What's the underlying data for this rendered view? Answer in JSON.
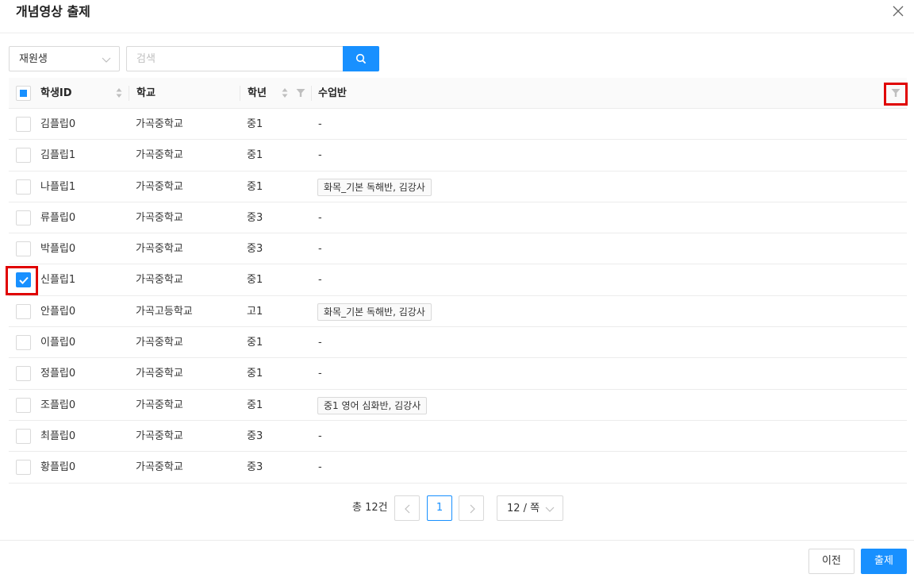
{
  "modal": {
    "title": "개념영상 출제"
  },
  "toolbar": {
    "filter_select_value": "재원생",
    "search_placeholder": "검색"
  },
  "table": {
    "columns": {
      "student_id": "학생ID",
      "school": "학교",
      "grade": "학년",
      "class": "수업반"
    },
    "rows": [
      {
        "name": "김플립0",
        "school": "가곡중학교",
        "grade": "중1",
        "class": "-",
        "class_is_tag": false,
        "checked": false
      },
      {
        "name": "김플립1",
        "school": "가곡중학교",
        "grade": "중1",
        "class": "-",
        "class_is_tag": false,
        "checked": false
      },
      {
        "name": "나플립1",
        "school": "가곡중학교",
        "grade": "중1",
        "class": "화목_기본 독해반, 김강사",
        "class_is_tag": true,
        "checked": false
      },
      {
        "name": "류플립0",
        "school": "가곡중학교",
        "grade": "중3",
        "class": "-",
        "class_is_tag": false,
        "checked": false
      },
      {
        "name": "박플립0",
        "school": "가곡중학교",
        "grade": "중3",
        "class": "-",
        "class_is_tag": false,
        "checked": false
      },
      {
        "name": "신플립1",
        "school": "가곡중학교",
        "grade": "중1",
        "class": "-",
        "class_is_tag": false,
        "checked": true
      },
      {
        "name": "안플립0",
        "school": "가곡고등학교",
        "grade": "고1",
        "class": "화목_기본 독해반, 김강사",
        "class_is_tag": true,
        "checked": false
      },
      {
        "name": "이플립0",
        "school": "가곡중학교",
        "grade": "중1",
        "class": "-",
        "class_is_tag": false,
        "checked": false
      },
      {
        "name": "정플립0",
        "school": "가곡중학교",
        "grade": "중1",
        "class": "-",
        "class_is_tag": false,
        "checked": false
      },
      {
        "name": "조플립0",
        "school": "가곡중학교",
        "grade": "중1",
        "class": "중1 영어 심화반, 김강사",
        "class_is_tag": true,
        "checked": false
      },
      {
        "name": "최플립0",
        "school": "가곡중학교",
        "grade": "중3",
        "class": "-",
        "class_is_tag": false,
        "checked": false
      },
      {
        "name": "황플립0",
        "school": "가곡중학교",
        "grade": "중3",
        "class": "-",
        "class_is_tag": false,
        "checked": false
      }
    ]
  },
  "pagination": {
    "total_label": "총 12건",
    "current_page": "1",
    "page_size_label": "12 / 쪽"
  },
  "footer": {
    "prev_label": "이전",
    "submit_label": "출제"
  },
  "colors": {
    "accent": "#1890ff",
    "highlight": "#e00000"
  },
  "icons": {
    "close": "close-icon",
    "search": "search-icon",
    "sort": "sort-icon",
    "filter": "filter-icon",
    "check": "check-icon",
    "chevron_left": "chevron-left-icon",
    "chevron_right": "chevron-right-icon",
    "chevron_down": "chevron-down-icon"
  }
}
